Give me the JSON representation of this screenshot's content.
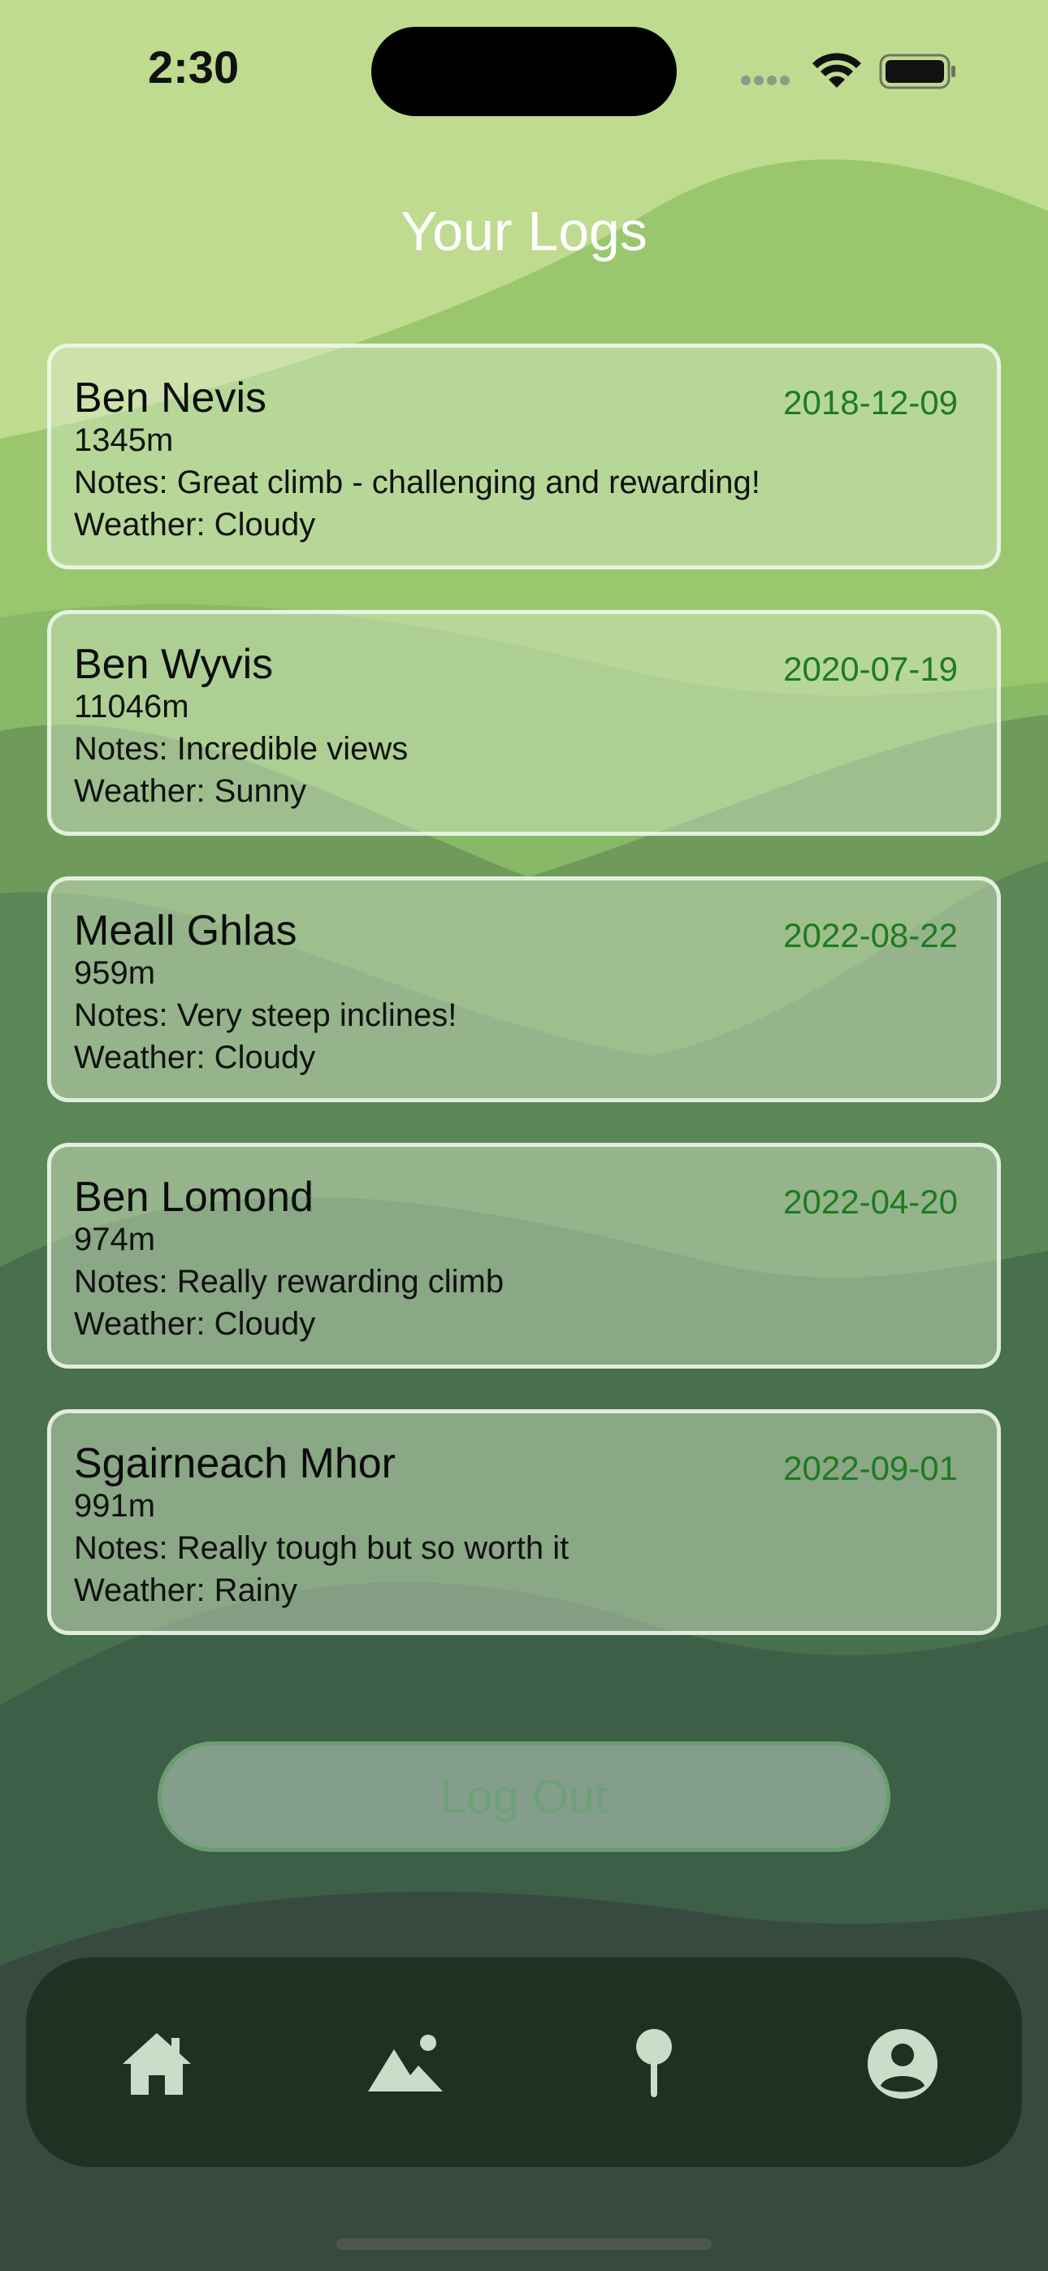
{
  "status_bar": {
    "time": "2:30"
  },
  "header": {
    "title": "Your Logs"
  },
  "logs": [
    {
      "name": "Ben Nevis",
      "date": "2018-12-09",
      "height": "1345m",
      "notes": "Notes: Great climb - challenging and rewarding!",
      "weather": "Weather: Cloudy"
    },
    {
      "name": "Ben Wyvis",
      "date": "2020-07-19",
      "height": "11046m",
      "notes": "Notes: Incredible views",
      "weather": "Weather: Sunny"
    },
    {
      "name": "Meall Ghlas",
      "date": "2022-08-22",
      "height": "959m",
      "notes": "Notes: Very steep inclines!",
      "weather": "Weather: Cloudy"
    },
    {
      "name": "Ben Lomond",
      "date": "2022-04-20",
      "height": "974m",
      "notes": "Notes: Really rewarding climb",
      "weather": "Weather: Cloudy"
    },
    {
      "name": "Sgairneach Mhor",
      "date": "2022-09-01",
      "height": "991m",
      "notes": "Notes: Really tough but so worth it",
      "weather": "Weather: Rainy"
    }
  ],
  "actions": {
    "logout_label": "Log Out"
  },
  "tab_bar": {
    "items": [
      {
        "icon": "home-icon"
      },
      {
        "icon": "mountain-icon"
      },
      {
        "icon": "pin-icon"
      },
      {
        "icon": "profile-icon"
      }
    ]
  },
  "colors": {
    "accent": "#1f7a1f",
    "logout_text": "#6fa079",
    "tab_bar_bg": "#1e3123",
    "tab_icon": "#c9ddc8"
  }
}
